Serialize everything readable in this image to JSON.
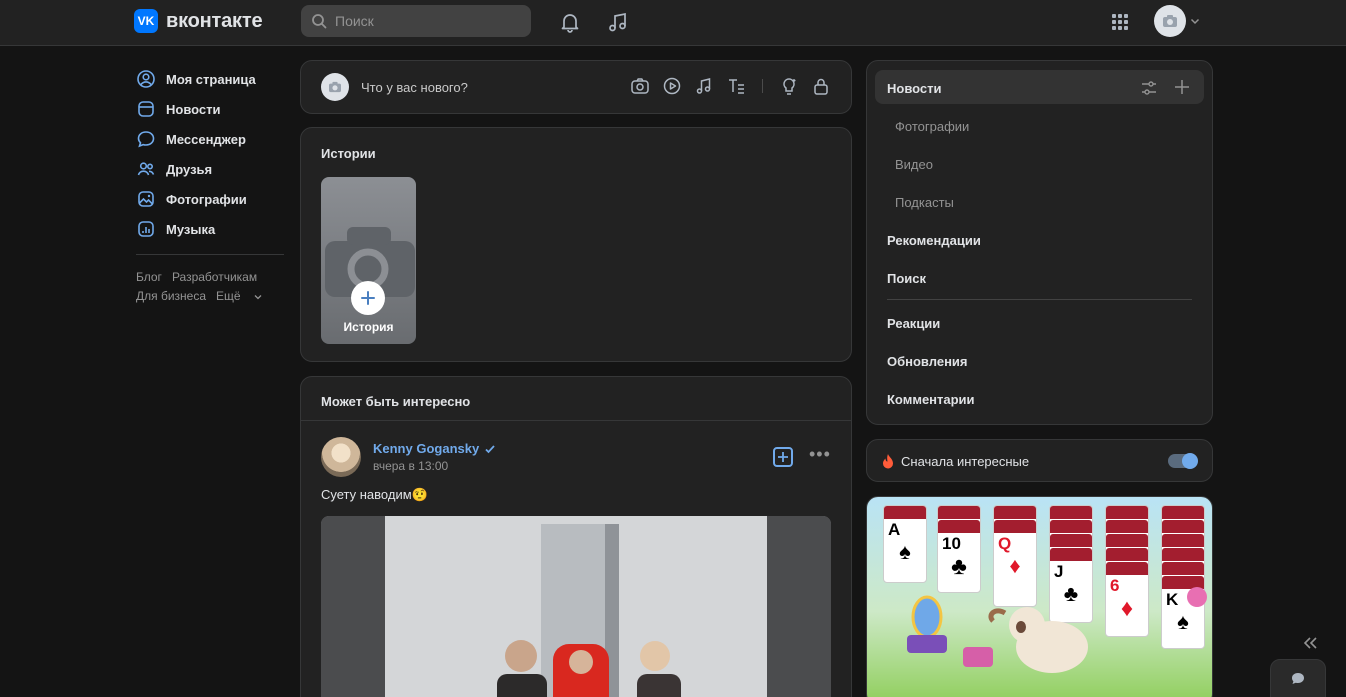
{
  "header": {
    "logo_text": "вконтакте",
    "logo_mark": "VK",
    "search_placeholder": "Поиск",
    "icons": [
      "bell-icon",
      "music-icon",
      "apps-grid-icon",
      "camera-avatar-icon",
      "chevron-down-icon"
    ]
  },
  "leftnav": {
    "items": [
      {
        "label": "Моя страница",
        "icon": "user-circle-icon"
      },
      {
        "label": "Новости",
        "icon": "news-icon"
      },
      {
        "label": "Мессенджер",
        "icon": "message-icon"
      },
      {
        "label": "Друзья",
        "icon": "friends-icon"
      },
      {
        "label": "Фотографии",
        "icon": "photo-icon"
      },
      {
        "label": "Музыка",
        "icon": "music-icon"
      }
    ],
    "footer": {
      "blog": "Блог",
      "developers": "Разработчикам",
      "business": "Для бизнеса",
      "more": "Ещё"
    }
  },
  "composer": {
    "placeholder": "Что у вас нового?"
  },
  "stories": {
    "title": "Истории",
    "tile_label": "История"
  },
  "interest": {
    "title": "Может быть интересно",
    "post": {
      "author": "Kenny Gogansky",
      "time": "вчера в 13:00",
      "text": "Суету наводим🤨"
    }
  },
  "rightnav": {
    "active": "Новости",
    "subs": [
      "Фотографии",
      "Видео",
      "Подкасты"
    ],
    "items_a": [
      "Рекомендации",
      "Поиск"
    ],
    "items_b": [
      "Реакции",
      "Обновления",
      "Комментарии"
    ]
  },
  "toggle": {
    "label": "Сначала интересные",
    "enabled": true
  },
  "ad": {
    "cards": [
      {
        "rank": "A",
        "suit": "♠",
        "color": "#000000"
      },
      {
        "rank": "10",
        "suit": "♣",
        "color": "#000000"
      },
      {
        "rank": "Q",
        "suit": "♦",
        "color": "#e0182a"
      },
      {
        "rank": "J",
        "suit": "♣",
        "color": "#000000"
      },
      {
        "rank": "6",
        "suit": "♦",
        "color": "#e0182a"
      },
      {
        "rank": "K",
        "suit": "♠",
        "color": "#000000"
      }
    ],
    "close": "✕"
  },
  "colors": {
    "accent": "#71aaeb",
    "brand": "#0077ff",
    "bg": "#141414",
    "card": "#222222"
  }
}
